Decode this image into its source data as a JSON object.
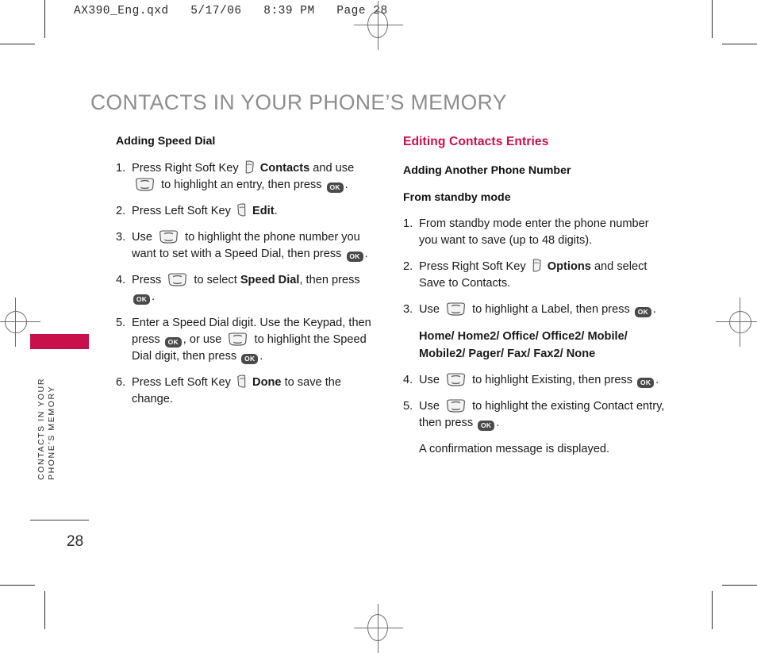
{
  "prepress": {
    "header": "AX390_Eng.qxd   5/17/06   8:39 PM   Page 28"
  },
  "page": {
    "title": "CONTACTS IN YOUR PHONE’S MEMORY",
    "side_tab_label": "CONTACTS IN YOUR\nPHONE’S MEMORY",
    "number": "28",
    "accent_color": "#c8104b",
    "title_color": "#8d8d8d"
  },
  "icons": {
    "left_soft_key": "left-soft-key-icon",
    "right_soft_key": "right-soft-key-icon",
    "navigation_pad": "navigation-pad-icon",
    "ok_key": "OK"
  },
  "left_column": {
    "heading": "Adding Speed Dial",
    "steps": [
      {
        "num": "1.",
        "parts": [
          {
            "t": "text",
            "v": "Press Right Soft Key "
          },
          {
            "t": "icon",
            "v": "right-soft-key"
          },
          {
            "t": "bold",
            "v": " Contacts"
          },
          {
            "t": "text",
            "v": " and use "
          },
          {
            "t": "icon",
            "v": "nav-pad"
          },
          {
            "t": "text",
            "v": " to highlight an entry, then press "
          },
          {
            "t": "icon",
            "v": "ok"
          },
          {
            "t": "text",
            "v": "."
          }
        ]
      },
      {
        "num": "2.",
        "parts": [
          {
            "t": "text",
            "v": "Press Left Soft Key "
          },
          {
            "t": "icon",
            "v": "left-soft-key"
          },
          {
            "t": "bold",
            "v": " Edit"
          },
          {
            "t": "text",
            "v": "."
          }
        ]
      },
      {
        "num": "3.",
        "parts": [
          {
            "t": "text",
            "v": "Use "
          },
          {
            "t": "icon",
            "v": "nav-pad"
          },
          {
            "t": "text",
            "v": " to highlight the phone number you want to set with a Speed Dial, then press "
          },
          {
            "t": "icon",
            "v": "ok"
          },
          {
            "t": "text",
            "v": "."
          }
        ]
      },
      {
        "num": "4.",
        "parts": [
          {
            "t": "text",
            "v": "Press "
          },
          {
            "t": "icon",
            "v": "nav-pad"
          },
          {
            "t": "text",
            "v": " to select "
          },
          {
            "t": "bold",
            "v": "Speed Dial"
          },
          {
            "t": "text",
            "v": ", then press "
          },
          {
            "t": "icon",
            "v": "ok"
          },
          {
            "t": "text",
            "v": "."
          }
        ]
      },
      {
        "num": "5.",
        "parts": [
          {
            "t": "text",
            "v": "Enter a Speed Dial digit. Use the Keypad, then press "
          },
          {
            "t": "icon",
            "v": "ok"
          },
          {
            "t": "text",
            "v": ", or use "
          },
          {
            "t": "icon",
            "v": "nav-pad"
          },
          {
            "t": "text",
            "v": " to highlight the Speed Dial digit, then press "
          },
          {
            "t": "icon",
            "v": "ok"
          },
          {
            "t": "text",
            "v": "."
          }
        ]
      },
      {
        "num": "6.",
        "parts": [
          {
            "t": "text",
            "v": "Press Left Soft Key "
          },
          {
            "t": "icon",
            "v": "left-soft-key"
          },
          {
            "t": "bold",
            "v": " Done"
          },
          {
            "t": "text",
            "v": " to save the change."
          }
        ]
      }
    ]
  },
  "right_column": {
    "section_title": "Editing Contacts Entries",
    "heading": "Adding Another Phone Number",
    "subheading": "From standby mode",
    "label_options": "Home/ Home2/ Office/ Office2/ Mobile/ Mobile2/ Pager/ Fax/ Fax2/ None",
    "confirmation": "A confirmation message is displayed.",
    "steps": [
      {
        "num": "1.",
        "parts": [
          {
            "t": "text",
            "v": "From standby mode enter the phone number you want to save (up to 48 digits)."
          }
        ]
      },
      {
        "num": "2.",
        "parts": [
          {
            "t": "text",
            "v": "Press Right Soft Key "
          },
          {
            "t": "icon",
            "v": "right-soft-key"
          },
          {
            "t": "bold",
            "v": " Options"
          },
          {
            "t": "text",
            "v": " and select Save to Contacts."
          }
        ]
      },
      {
        "num": "3.",
        "parts": [
          {
            "t": "text",
            "v": "Use "
          },
          {
            "t": "icon",
            "v": "nav-pad"
          },
          {
            "t": "text",
            "v": " to highlight a Label, then press "
          },
          {
            "t": "icon",
            "v": "ok"
          },
          {
            "t": "text",
            "v": "."
          }
        ]
      },
      {
        "num": "4.",
        "parts": [
          {
            "t": "text",
            "v": "Use "
          },
          {
            "t": "icon",
            "v": "nav-pad"
          },
          {
            "t": "text",
            "v": " to highlight Existing, then press "
          },
          {
            "t": "icon",
            "v": "ok"
          },
          {
            "t": "text",
            "v": "."
          }
        ]
      },
      {
        "num": "5.",
        "parts": [
          {
            "t": "text",
            "v": "Use "
          },
          {
            "t": "icon",
            "v": "nav-pad"
          },
          {
            "t": "text",
            "v": " to highlight the existing Contact entry, then press "
          },
          {
            "t": "icon",
            "v": "ok"
          },
          {
            "t": "text",
            "v": "."
          }
        ]
      }
    ]
  }
}
